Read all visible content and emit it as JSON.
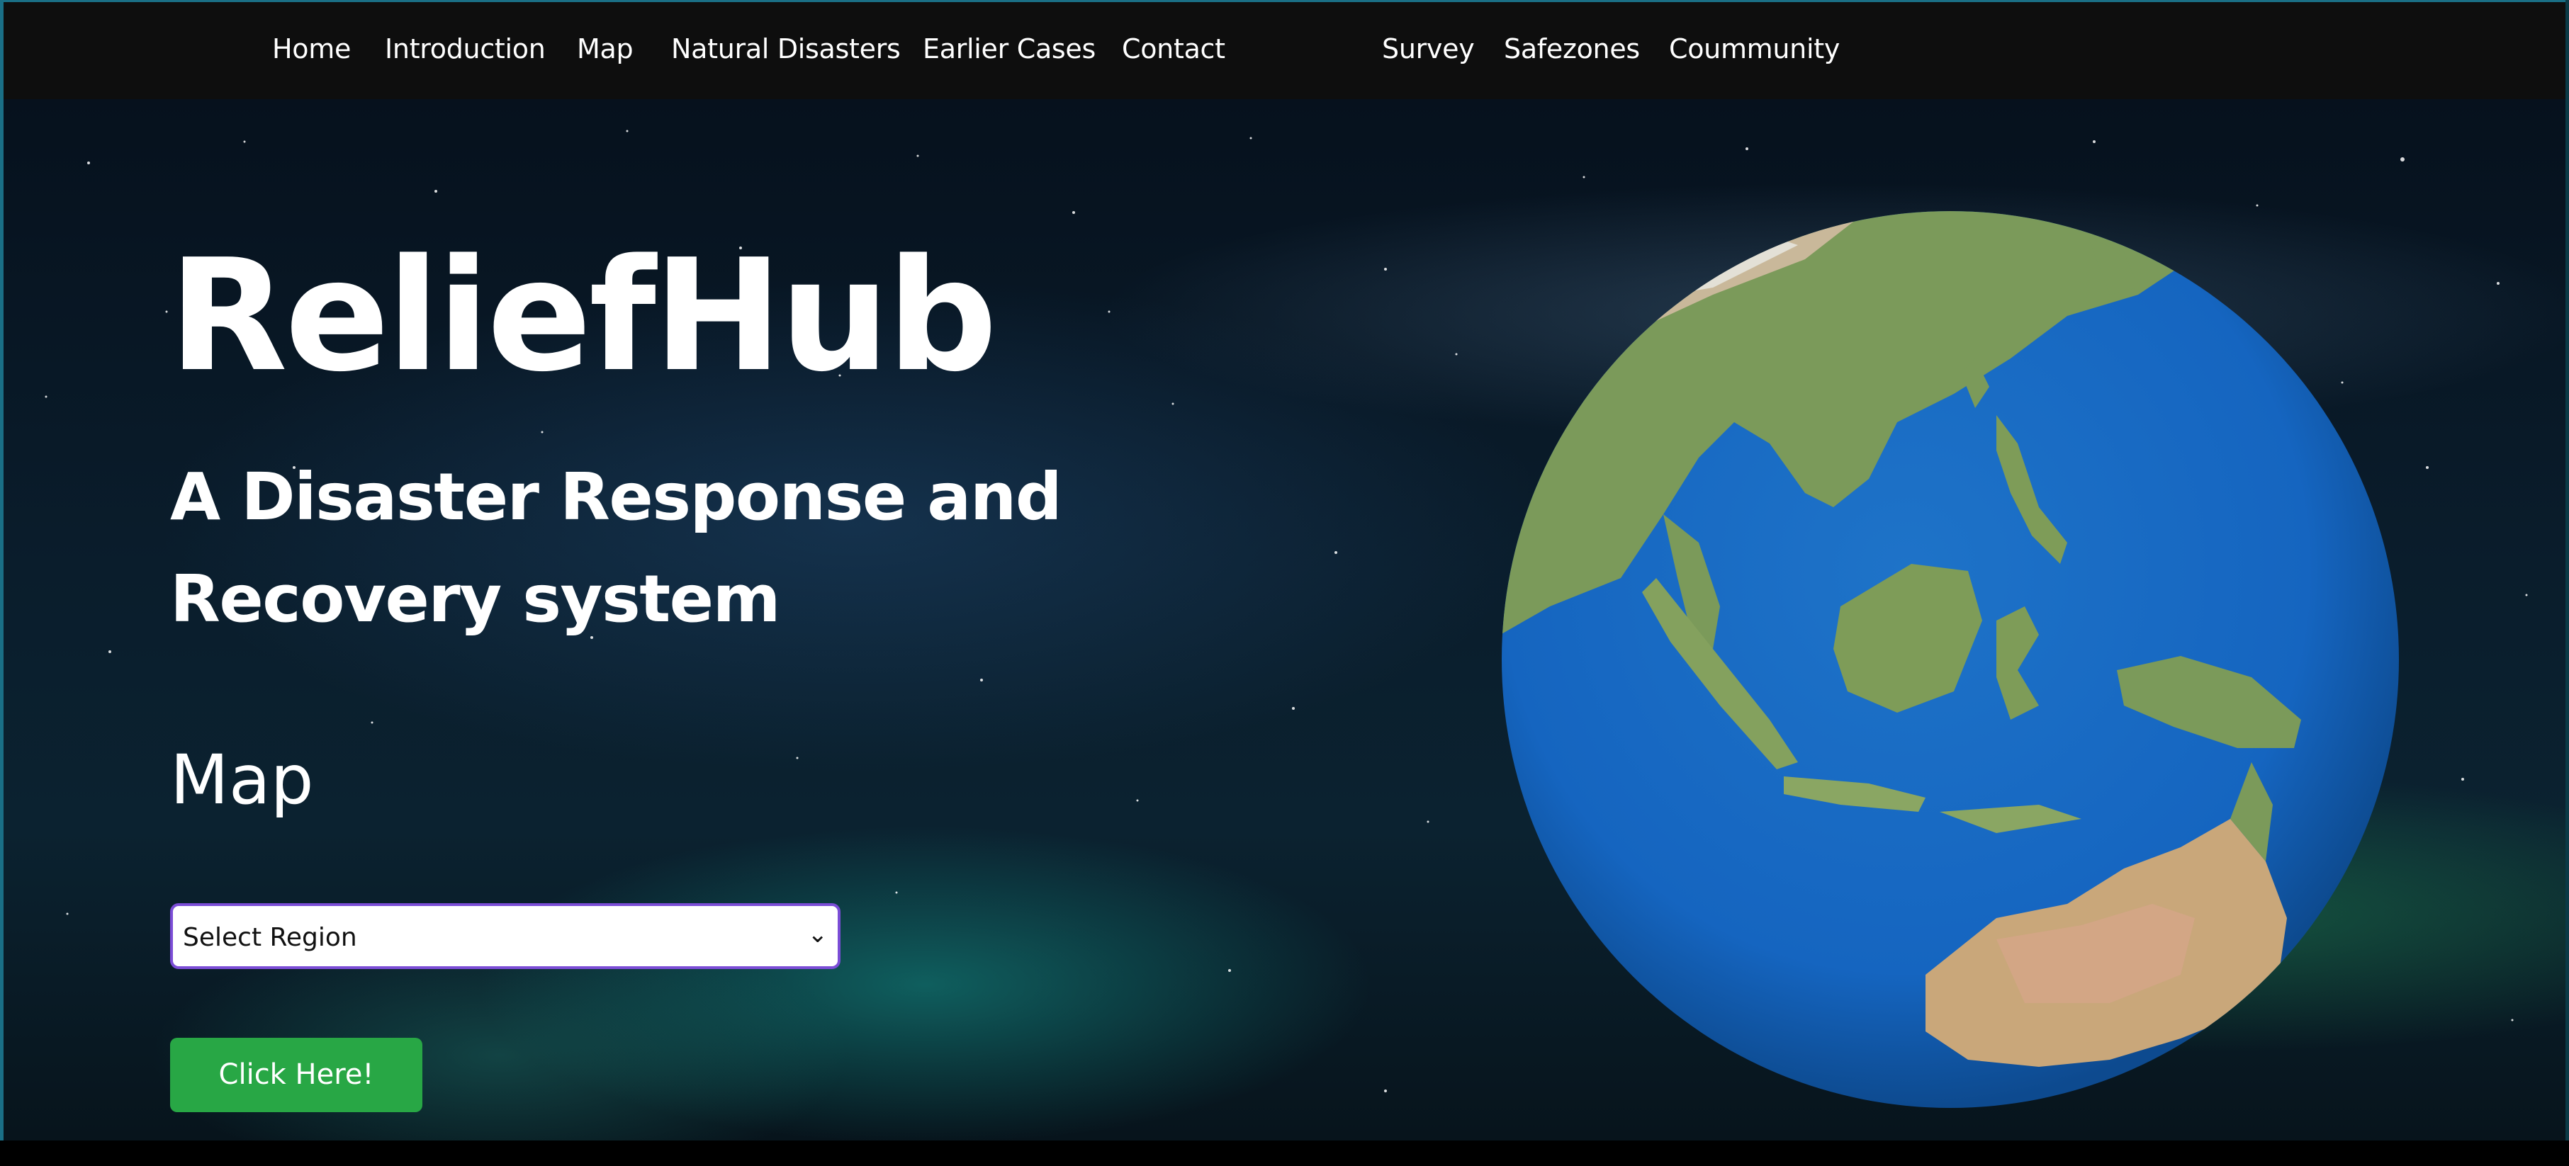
{
  "nav": {
    "left_items": [
      "Home",
      "Introduction",
      "Map",
      "Natural Disasters",
      "Earlier Cases",
      "Contact"
    ],
    "right_items": [
      "Survey",
      "Safezones",
      "Coummunity"
    ]
  },
  "hero": {
    "brand": "ReliefHub",
    "tagline_line1": "A Disaster Response and",
    "tagline_line2": "Recovery system",
    "map_heading": "Map",
    "region_select": {
      "selected": "Select Region"
    },
    "cta_label": "Click Here!"
  },
  "colors": {
    "navbar_bg": "#0e0e0e",
    "cta_bg": "#28a745",
    "select_border": "#7b4dd6",
    "ocean": "#1565c0"
  },
  "icons": [
    "chevron-down-icon",
    "earth-globe-image"
  ]
}
